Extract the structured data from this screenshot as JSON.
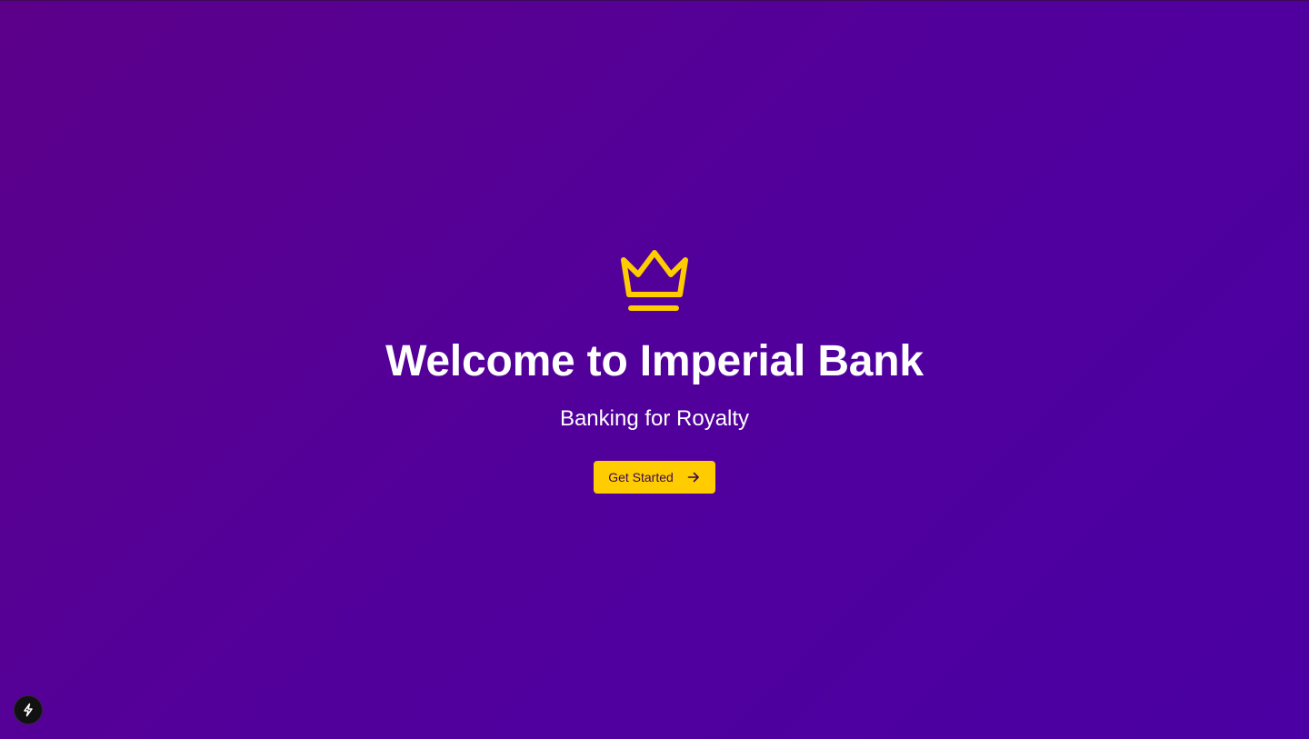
{
  "colors": {
    "background_start": "#5c008a",
    "background_end": "#4a00a3",
    "accent": "#ffcc00",
    "title_text": "#ffffff",
    "button_text": "#3a0a55"
  },
  "hero": {
    "logo_icon": "crown-icon",
    "title": "Welcome to Imperial Bank",
    "subtitle": "Banking for Royalty",
    "cta_label": "Get Started",
    "cta_icon": "arrow-right-icon"
  },
  "devtools": {
    "icon": "lightning-bolt-icon"
  }
}
